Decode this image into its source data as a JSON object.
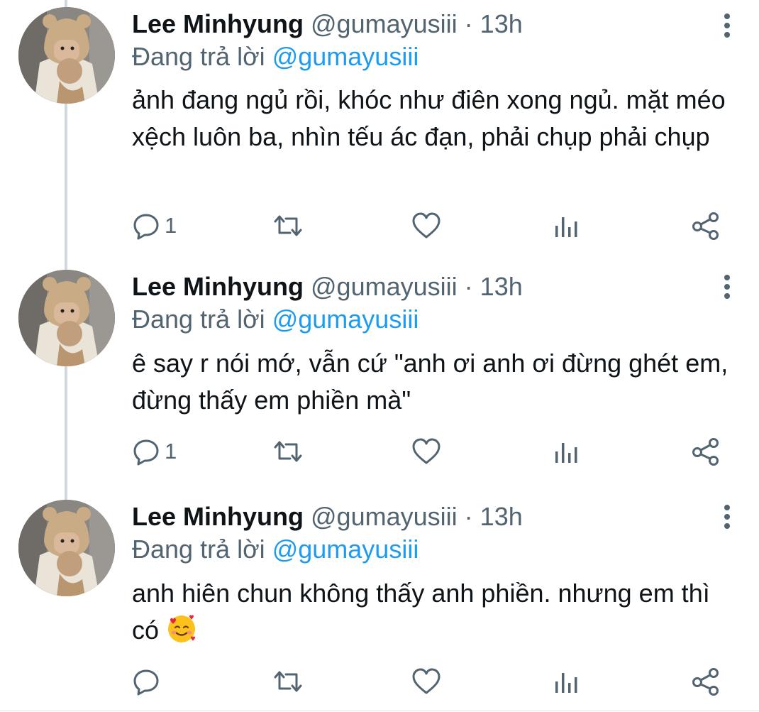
{
  "colors": {
    "text": "#0f1419",
    "muted": "#536471",
    "link": "#1d9bf0",
    "thread_line": "#cfd9de"
  },
  "tweets": [
    {
      "name": "Lee Minhyung",
      "handle": "@gumayusiii",
      "dot": "·",
      "time": "13h",
      "reply_prefix": "Đang trả lời",
      "reply_to": "@gumayusiii",
      "text": "ảnh đang ngủ rồi, khóc như điên xong ngủ. mặt méo xệch luôn ba, nhìn tếu ác đạn, phải chụp phải chụp",
      "reply_count": "1",
      "icons": [
        "reply-icon",
        "retweet-icon",
        "like-icon",
        "analytics-icon",
        "share-icon",
        "more-icon"
      ]
    },
    {
      "name": "Lee Minhyung",
      "handle": "@gumayusiii",
      "dot": "·",
      "time": "13h",
      "reply_prefix": "Đang trả lời",
      "reply_to": "@gumayusiii",
      "text": "ê say r nói mớ, vẫn cứ \"anh ơi anh ơi đừng ghét em, đừng thấy em phiền mà\"",
      "reply_count": "1",
      "icons": [
        "reply-icon",
        "retweet-icon",
        "like-icon",
        "analytics-icon",
        "share-icon",
        "more-icon"
      ]
    },
    {
      "name": "Lee Minhyung",
      "handle": "@gumayusiii",
      "dot": "·",
      "time": "13h",
      "reply_prefix": "Đang trả lời",
      "reply_to": "@gumayusiii",
      "text": "anh hiên chun không thấy anh phiền. nhưng em thì có",
      "emoji": "smiling-face-with-hearts",
      "reply_count": "",
      "icons": [
        "reply-icon",
        "retweet-icon",
        "like-icon",
        "analytics-icon",
        "share-icon",
        "more-icon"
      ]
    }
  ]
}
